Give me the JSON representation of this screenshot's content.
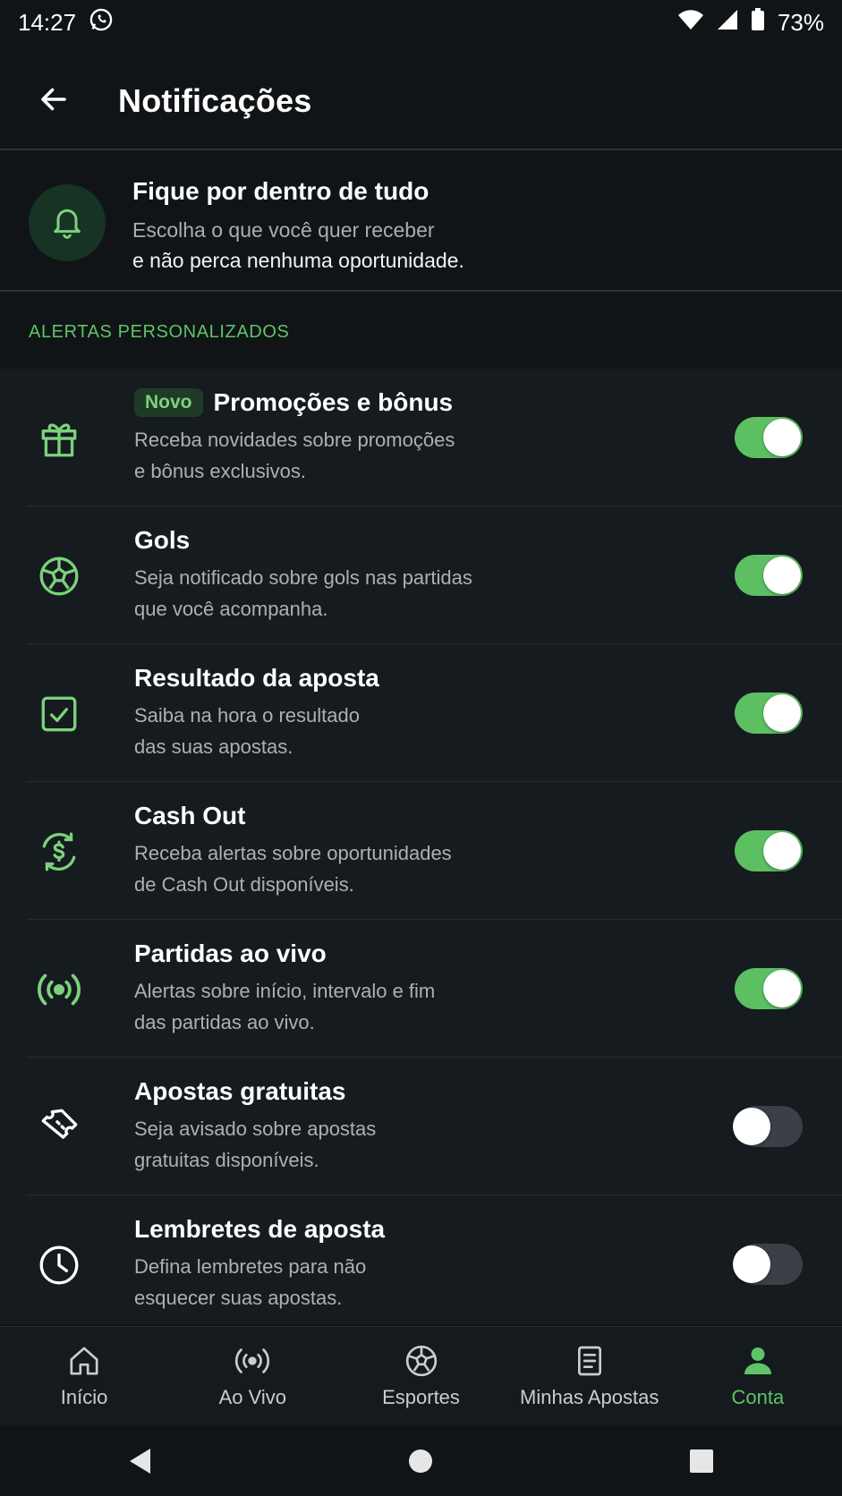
{
  "status_bar": {
    "time": "14:27",
    "battery": "73%",
    "icons": [
      "whatsapp-icon",
      "wifi-icon",
      "signal-icon",
      "battery-icon"
    ]
  },
  "header": {
    "title": "Notificações",
    "back_icon": "arrow-left-icon"
  },
  "intro": {
    "title": "Fique por dentro de tudo",
    "line1": "Escolha o que você quer receber",
    "line2": "e não perca nenhuma oportunidade.",
    "icon": "bell-icon"
  },
  "section": {
    "label": "ALERTAS PERSONALIZADOS"
  },
  "items": [
    {
      "badge": "Novo",
      "title": "Promoções e bônus",
      "desc1": "Receba novidades sobre promoções",
      "desc2": "e bônus exclusivos.",
      "icon": "gift-icon",
      "enabled": true
    },
    {
      "title": "Gols",
      "desc1": "Seja notificado sobre gols nas partidas",
      "desc2": "que você acompanha.",
      "icon": "soccer-ball-icon",
      "enabled": true
    },
    {
      "title": "Resultado da aposta",
      "desc1": "Saiba na hora o resultado",
      "desc2": "das suas apostas.",
      "icon": "check-square-icon",
      "enabled": true
    },
    {
      "title": "Cash Out",
      "desc1": "Receba alertas sobre oportunidades",
      "desc2": "de Cash Out disponíveis.",
      "icon": "cash-out-icon",
      "enabled": true
    },
    {
      "title": "Partidas ao vivo",
      "desc1": "Alertas sobre início, intervalo e fim",
      "desc2": "das partidas ao vivo.",
      "icon": "live-broadcast-icon",
      "enabled": true
    },
    {
      "title": "Apostas gratuitas",
      "desc1": "Seja avisado sobre apostas",
      "desc2": "gratuitas disponíveis.",
      "icon": "ticket-icon",
      "enabled": false
    },
    {
      "title": "Lembretes de aposta",
      "desc1": "Defina lembretes para não",
      "desc2": "esquecer suas apostas.",
      "icon": "clock-icon",
      "enabled": false
    }
  ],
  "bottom_nav": [
    {
      "label": "Início",
      "icon": "home-icon",
      "active": false
    },
    {
      "label": "Ao Vivo",
      "icon": "live-icon",
      "active": false
    },
    {
      "label": "Esportes",
      "icon": "soccer-ball-icon",
      "active": false
    },
    {
      "label": "Minhas Apostas",
      "icon": "document-icon",
      "active": false
    },
    {
      "label": "Conta",
      "icon": "user-icon",
      "active": true
    }
  ],
  "colors": {
    "accent": "#5fc465",
    "background": "#101417",
    "toggle_on": "#5cc062",
    "toggle_off": "#3a4045"
  }
}
